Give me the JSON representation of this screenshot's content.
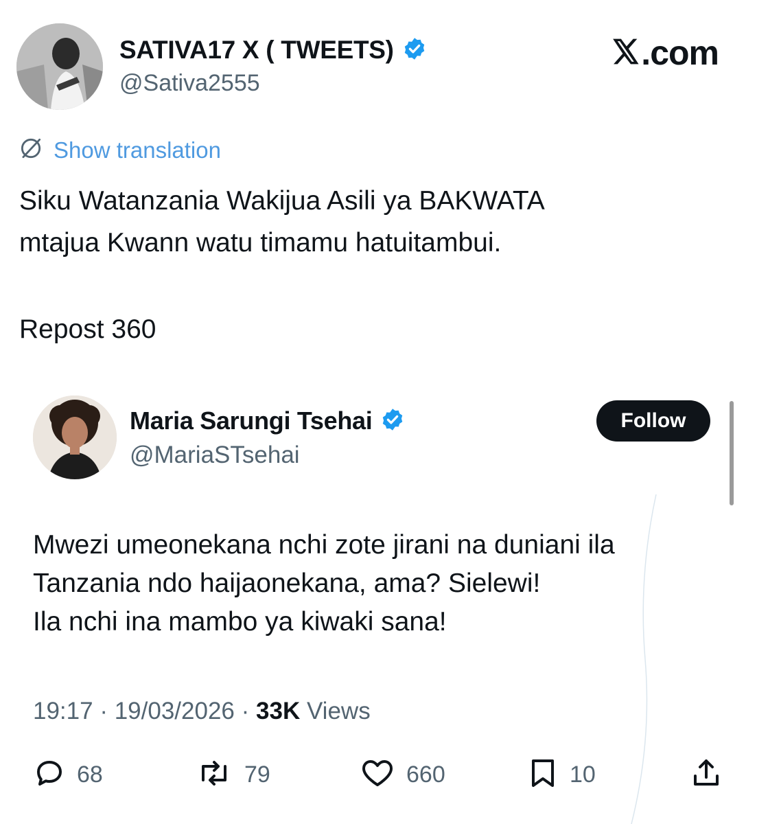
{
  "outer_post": {
    "author_name": "SATIVA17 X ( TWEETS)",
    "author_handle": "@Sativa2555",
    "verified": true,
    "avatar_icon": "user-photo-avatar",
    "source_site": ".com",
    "show_translation": "Show translation",
    "body_lines": [
      "Siku Watanzania Wakijua Asili ya BAKWATA",
      "mtajua Kwann watu timamu hatuitambui."
    ],
    "repost_text": "Repost 360"
  },
  "quoted_post": {
    "author_name": "Maria Sarungi Tsehai",
    "author_handle": "@MariaSTsehai",
    "verified": true,
    "avatar_icon": "user-photo-avatar",
    "follow_label": "Follow",
    "body_lines": [
      "Mwezi umeonekana nchi zote jirani na duniani ila",
      "Tanzania ndo haijaonekana, ama? Sielewi!",
      "Ila nchi ina mambo ya kiwaki sana!"
    ],
    "meta": {
      "time": "19:17",
      "date": "19/03/2026",
      "views_count": "33K",
      "views_label": "Views"
    },
    "actions": {
      "replies": "68",
      "reposts": "79",
      "likes": "660",
      "bookmarks": "10"
    }
  },
  "colors": {
    "text_primary": "#0f1419",
    "text_secondary": "#536471",
    "link_blue": "#4f9ae0",
    "verified_blue": "#1d9bf0",
    "button_dark": "#0f1419"
  }
}
